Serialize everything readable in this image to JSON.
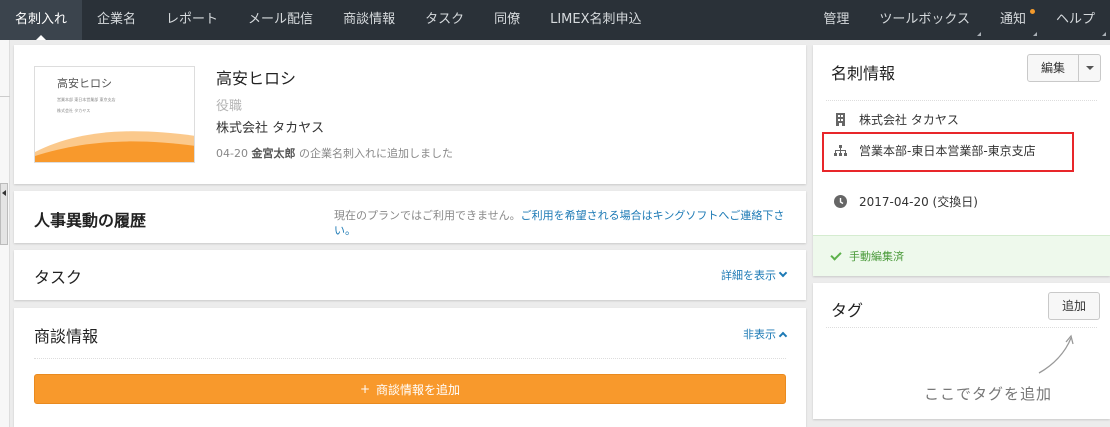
{
  "nav": {
    "left": [
      "名刺入れ",
      "企業名",
      "レポート",
      "メール配信",
      "商談情報",
      "タスク",
      "同僚",
      "LIMEX名刺申込"
    ],
    "right": [
      "管理",
      "ツールボックス",
      "通知",
      "ヘルプ"
    ]
  },
  "profile": {
    "card_image": {
      "name": "高安ヒロシ",
      "line1": "営業本部 東日本営業部 東京支店",
      "line2": "株式会社 タカヤス"
    },
    "name": "高安ヒロシ",
    "title": "役職",
    "company": "株式会社 タカヤス",
    "note_date": "04-20",
    "note_user": "金宮太郎",
    "note_text": "の企業名刺入れに追加しました"
  },
  "history": {
    "title": "人事異動の履歴",
    "msg_plain": "現在のプランではご利用できません。",
    "msg_link": "ご利用を希望される場合はキングソフトへご連絡下さい。"
  },
  "task": {
    "title": "タスク",
    "link": "詳細を表示"
  },
  "deals": {
    "title": "商談情報",
    "link": "非表示",
    "add_button": "商談情報を追加"
  },
  "info": {
    "title": "名刺情報",
    "edit_button": "編集",
    "company": "株式会社 タカヤス",
    "department": "営業本部-東日本営業部-東京支店",
    "date": "2017-04-20 (交換日)",
    "edited": "手動編集済"
  },
  "tags": {
    "title": "タグ",
    "add_button": "追加",
    "hint": "ここでタグを追加"
  },
  "colors": {
    "nav_bg": "#2a3138",
    "accent_orange": "#f8992c",
    "highlight_red": "#e8262a",
    "link_blue": "#1d7ab5",
    "success_green": "#5cb14a"
  }
}
